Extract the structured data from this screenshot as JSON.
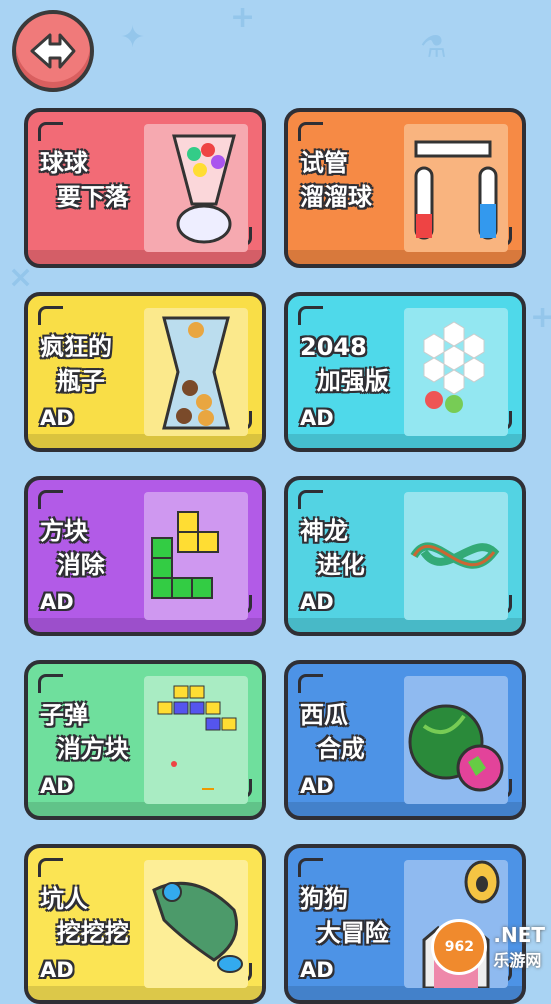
{
  "colors": {
    "background": "#a9d3f3",
    "outline": "#2f2f35"
  },
  "cards": [
    {
      "title": "球球\n  要下落",
      "ad": "",
      "bg": "#f26b76",
      "thumb_bg": "#f6a9b0",
      "thumb_icon": "ball-cup-icon"
    },
    {
      "title": "试管\n溜溜球",
      "ad": "",
      "bg": "#f68a45",
      "thumb_bg": "#f9b47f",
      "thumb_icon": "test-tube-icon"
    },
    {
      "title": "疯狂的\n  瓶子",
      "ad": "AD",
      "bg": "#f9de47",
      "thumb_bg": "#fbe98c",
      "thumb_icon": "bottle-balls-icon"
    },
    {
      "title": "2048\n  加强版",
      "ad": "AD",
      "bg": "#4fd9ea",
      "thumb_bg": "#93e7f1",
      "thumb_icon": "hex-2048-icon"
    },
    {
      "title": "方块\n  消除",
      "ad": "AD",
      "bg": "#b25be7",
      "thumb_bg": "#cf98f0",
      "thumb_icon": "blocks-icon"
    },
    {
      "title": "神龙\n  进化",
      "ad": "AD",
      "bg": "#53d3e3",
      "thumb_bg": "#98e4ee",
      "thumb_icon": "dragon-icon"
    },
    {
      "title": "子弹\n  消方块",
      "ad": "AD",
      "bg": "#6fdf9d",
      "thumb_bg": "#a9ecc3",
      "thumb_icon": "bullet-blocks-icon"
    },
    {
      "title": "西瓜\n  合成",
      "ad": "AD",
      "bg": "#4d93e6",
      "thumb_bg": "#8fbaf0",
      "thumb_icon": "watermelon-icon"
    },
    {
      "title": "坑人\n  挖挖挖",
      "ad": "AD",
      "bg": "#fbe454",
      "thumb_bg": "#fdee97",
      "thumb_icon": "dig-icon"
    },
    {
      "title": "狗狗\n  大冒险",
      "ad": "AD",
      "bg": "#4d93e6",
      "thumb_bg": "#8fbaf0",
      "thumb_icon": "dog-icon"
    }
  ],
  "watermark": {
    "badge": "962",
    "text": ".NET",
    "sub": "乐游网"
  }
}
